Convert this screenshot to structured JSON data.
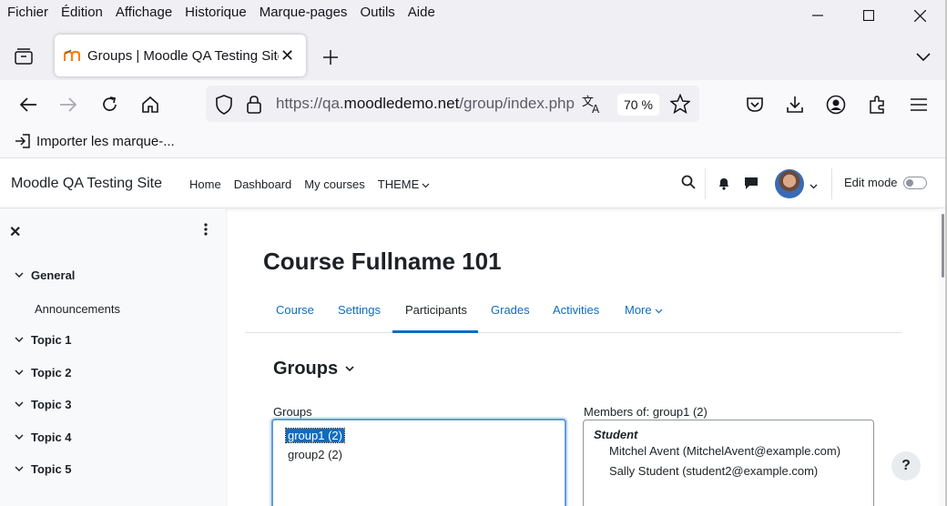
{
  "menubar": {
    "items": [
      "Fichier",
      "Édition",
      "Affichage",
      "Historique",
      "Marque-pages",
      "Outils",
      "Aide"
    ]
  },
  "tab": {
    "title": "Groups | Moodle QA Testing Site",
    "close_icon": "close-icon"
  },
  "address": {
    "url_prefix": "https://qa.",
    "url_domain": "moodledemo.net",
    "url_suffix": "/group/index.php",
    "zoom": "70 %"
  },
  "bookmarks": {
    "import_label": "Importer les marque-..."
  },
  "moodle_nav": {
    "brand": "Moodle QA Testing Site",
    "links": [
      "Home",
      "Dashboard",
      "My courses",
      "THEME"
    ],
    "edit_mode_label": "Edit mode",
    "edit_mode_on": false
  },
  "drawer": {
    "items": [
      {
        "label": "General",
        "expanded": true
      },
      {
        "label": "Topic 1",
        "expanded": false
      },
      {
        "label": "Topic 2",
        "expanded": false
      },
      {
        "label": "Topic 3",
        "expanded": false
      },
      {
        "label": "Topic 4",
        "expanded": false
      },
      {
        "label": "Topic 5",
        "expanded": false
      }
    ],
    "sub_items": [
      "Announcements"
    ]
  },
  "course": {
    "title": "Course Fullname 101",
    "tabs": [
      "Course",
      "Settings",
      "Participants",
      "Grades",
      "Activities",
      "More"
    ],
    "active_tab": "Participants"
  },
  "groups": {
    "heading": "Groups",
    "list_label": "Groups",
    "options": [
      "group1 (2)",
      "group2 (2)"
    ],
    "selected": "group1 (2)",
    "members_label": "Members of: group1 (2)",
    "role": "Student",
    "members": [
      "Mitchel Avent (MitchelAvent@example.com)",
      "Sally Student (student2@example.com)"
    ]
  },
  "help_button": "?",
  "colors": {
    "accent": "#0f6cbf",
    "focus_border": "#5f9bd8",
    "drawer_bg": "#f8f9fa",
    "chrome_bg": "#f0f0f4"
  }
}
